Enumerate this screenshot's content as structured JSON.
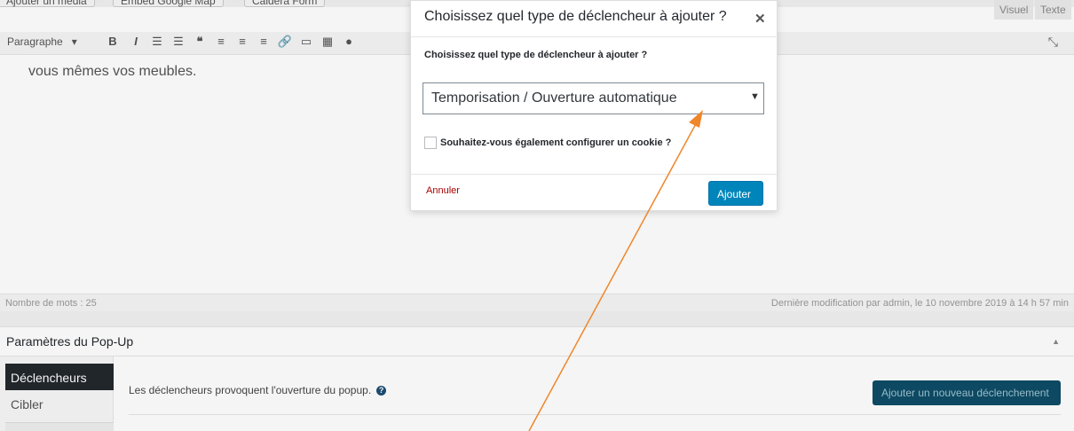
{
  "media_buttons": [
    "Ajouter un média",
    "Embed Google Map",
    "Caldera Form"
  ],
  "view_tabs": {
    "visual": "Visuel",
    "text": "Texte"
  },
  "toolbar": {
    "format_select": "Paragraphe"
  },
  "editor": {
    "content": "vous mêmes vos meubles."
  },
  "status_bar": {
    "word_count": "Nombre de mots : 25",
    "last_modified": "Dernière modification par admin, le 10 novembre 2019 à 14 h 57 min"
  },
  "metabox": {
    "title": "Paramètres du Pop-Up",
    "tabs": [
      "Déclencheurs",
      "Cibler"
    ],
    "description": "Les déclencheurs provoquent l'ouverture du popup.",
    "add_button": "Ajouter un nouveau déclenchement"
  },
  "modal": {
    "title": "Choisissez quel type de déclencheur à ajouter ?",
    "question": "Choisissez quel type de déclencheur à ajouter ?",
    "select_value": "Temporisation / Ouverture automatique",
    "checkbox_label": "Souhaitez-vous également configurer un cookie ?",
    "cancel": "Annuler",
    "submit": "Ajouter"
  },
  "colors": {
    "primary": "#0085ba",
    "arrow": "#f0862a",
    "danger": "#aa0000",
    "dark": "#23282d"
  }
}
